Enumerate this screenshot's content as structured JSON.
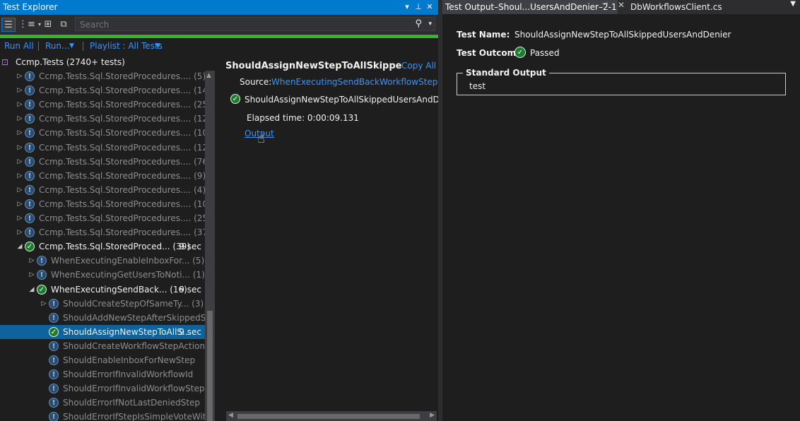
{
  "left_panel": {
    "title": "Test Explorer",
    "search_placeholder": "Search",
    "run_all": "Run All",
    "run": "Run...",
    "playlist": "Playlist : All Tests",
    "root_label": "Ccmp.Tests (2740+ tests)",
    "tree": [
      {
        "label": "Ccmp.Tests.Sql.StoredProcedures.... (5)",
        "state": "warn",
        "level": 1,
        "exp": "▷",
        "duration": ""
      },
      {
        "label": "Ccmp.Tests.Sql.StoredProcedures.... (14)",
        "state": "warn",
        "level": 1,
        "exp": "▷",
        "duration": ""
      },
      {
        "label": "Ccmp.Tests.Sql.StoredProcedures.... (25)",
        "state": "warn",
        "level": 1,
        "exp": "▷",
        "duration": ""
      },
      {
        "label": "Ccmp.Tests.Sql.StoredProcedures.... (12)",
        "state": "warn",
        "level": 1,
        "exp": "▷",
        "duration": ""
      },
      {
        "label": "Ccmp.Tests.Sql.StoredProcedures.... (10)",
        "state": "warn",
        "level": 1,
        "exp": "▷",
        "duration": ""
      },
      {
        "label": "Ccmp.Tests.Sql.StoredProcedures.... (12)",
        "state": "warn",
        "level": 1,
        "exp": "▷",
        "duration": ""
      },
      {
        "label": "Ccmp.Tests.Sql.StoredProcedures.... (76)",
        "state": "warn",
        "level": 1,
        "exp": "▷",
        "duration": ""
      },
      {
        "label": "Ccmp.Tests.Sql.StoredProcedures.... (9)",
        "state": "warn",
        "level": 1,
        "exp": "▷",
        "duration": ""
      },
      {
        "label": "Ccmp.Tests.Sql.StoredProcedures.... (4)",
        "state": "warn",
        "level": 1,
        "exp": "▷",
        "duration": ""
      },
      {
        "label": "Ccmp.Tests.Sql.StoredProcedures.... (10)",
        "state": "warn",
        "level": 1,
        "exp": "▷",
        "duration": ""
      },
      {
        "label": "Ccmp.Tests.Sql.StoredProcedures.... (25)",
        "state": "warn",
        "level": 1,
        "exp": "▷",
        "duration": ""
      },
      {
        "label": "Ccmp.Tests.Sql.StoredProcedures.... (37)",
        "state": "warn",
        "level": 1,
        "exp": "▷",
        "duration": ""
      },
      {
        "label": "Ccmp.Tests.Sql.StoredProced... (39)",
        "state": "pass",
        "level": 1,
        "exp": "◢",
        "duration": "9 sec"
      },
      {
        "label": "WhenExecutingEnableInboxFor... (5)",
        "state": "warn",
        "level": 2,
        "exp": "▷",
        "duration": ""
      },
      {
        "label": "WhenExecutingGetUsersToNoti... (1)",
        "state": "warn",
        "level": 2,
        "exp": "▷",
        "duration": ""
      },
      {
        "label": "WhenExecutingSendBack... (16)",
        "state": "pass",
        "level": 2,
        "exp": "◢",
        "duration": "9 sec"
      },
      {
        "label": "ShouldCreateStepOfSameTy... (3)",
        "state": "warn",
        "level": 3,
        "exp": "▷",
        "duration": ""
      },
      {
        "label": "ShouldAddNewStepAfterSkippedS...",
        "state": "warn",
        "level": 3,
        "exp": "",
        "duration": ""
      },
      {
        "label": "ShouldAssignNewStepToAllS...",
        "state": "pass",
        "level": 3,
        "exp": "",
        "duration": "9 sec",
        "selected": true
      },
      {
        "label": "ShouldCreateWorkflowStepAction",
        "state": "warn",
        "level": 3,
        "exp": "",
        "duration": ""
      },
      {
        "label": "ShouldEnableInboxForNewStep",
        "state": "warn",
        "level": 3,
        "exp": "",
        "duration": ""
      },
      {
        "label": "ShouldErrorIfInvalidWorkflowId",
        "state": "warn",
        "level": 3,
        "exp": "",
        "duration": ""
      },
      {
        "label": "ShouldErrorIfInvalidWorkflowStepId",
        "state": "warn",
        "level": 3,
        "exp": "",
        "duration": ""
      },
      {
        "label": "ShouldErrorIfNotLastDeniedStep",
        "state": "warn",
        "level": 3,
        "exp": "",
        "duration": ""
      },
      {
        "label": "ShouldErrorIfStepIsSimpleVoteWit...",
        "state": "warn",
        "level": 3,
        "exp": "",
        "duration": ""
      }
    ]
  },
  "detail": {
    "title": "ShouldAssignNewStepToAllSkippedU...",
    "copy_all": "Copy All",
    "source_label": "Source:",
    "source_link": "WhenExecutingSendBackWorkflowStep.cs line",
    "result_name": "ShouldAssignNewStepToAllSkippedUsersAndDenier",
    "elapsed": "Elapsed time: 0:00:09.131",
    "output_link": "Output"
  },
  "right_panel": {
    "tab_active": "Test Output–Shoul...UsersAndDenier–2-1",
    "tab_other": "DbWorkflowsClient.cs",
    "test_name_label": "Test Name:",
    "test_name_value": "ShouldAssignNewStepToAllSkippedUsersAndDenier",
    "test_outcome_label": "Test Outcome:",
    "test_outcome_value": "Passed",
    "std_output_label": "Standard Output",
    "std_output_value": "test"
  },
  "colors": {
    "accent": "#007acc",
    "pass": "#1e7a2f",
    "progress": "#35b42c",
    "link": "#3794ff"
  }
}
